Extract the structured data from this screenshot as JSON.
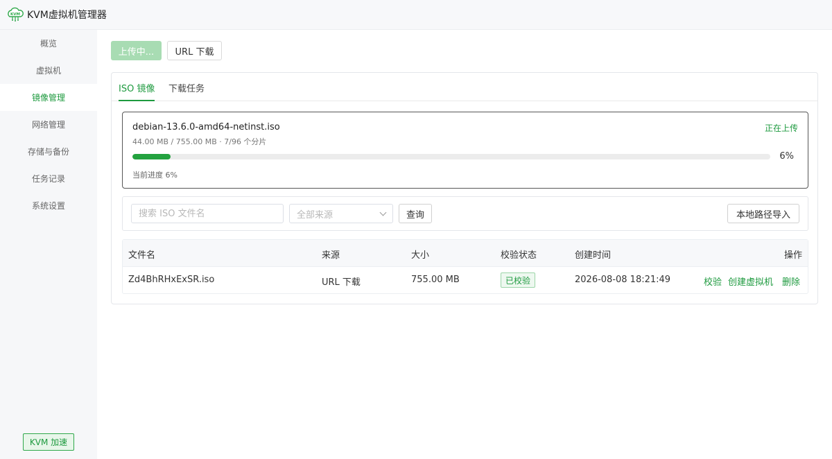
{
  "app": {
    "title": "KVM虚拟机管理器",
    "logo_text": "KVM"
  },
  "sidebar": {
    "items": [
      {
        "label": "概览"
      },
      {
        "label": "虚拟机"
      },
      {
        "label": "镜像管理"
      },
      {
        "label": "网络管理"
      },
      {
        "label": "存储与备份"
      },
      {
        "label": "任务记录"
      },
      {
        "label": "系统设置"
      }
    ],
    "active_index": 2,
    "accelerate_label": "KVM 加速"
  },
  "toolbar": {
    "upload_label": "上传中...",
    "url_download_label": "URL 下载"
  },
  "tabs": [
    {
      "label": "ISO 镜像"
    },
    {
      "label": "下载任务"
    }
  ],
  "upload": {
    "filename": "debian-13.6.0-amd64-netinst.iso",
    "status": "正在上传",
    "meta": "44.00 MB / 755.00 MB · 7/96 个分片",
    "percent_label": "6%",
    "progress_fraction": 0.06,
    "current_label": "当前进度 6%"
  },
  "filters": {
    "search_placeholder": "搜索 ISO 文件名",
    "source_placeholder": "全部来源",
    "query_label": "查询",
    "import_label": "本地路径导入"
  },
  "table": {
    "headers": {
      "name": "文件名",
      "source": "来源",
      "size": "大小",
      "verify": "校验状态",
      "created": "创建时间",
      "actions": "操作"
    },
    "rows": [
      {
        "name": "Zd4BhRHxExSR.iso",
        "source": "URL 下载",
        "size": "755.00 MB",
        "verify": "已校验",
        "created": "2026-08-08 18:21:49",
        "actions": [
          "校验",
          "创建虚拟机",
          "删除"
        ]
      }
    ]
  },
  "colors": {
    "accent": "#1e9a3f",
    "progress": "#23a23f",
    "upload_button_disabled": "#a8dcb3"
  }
}
